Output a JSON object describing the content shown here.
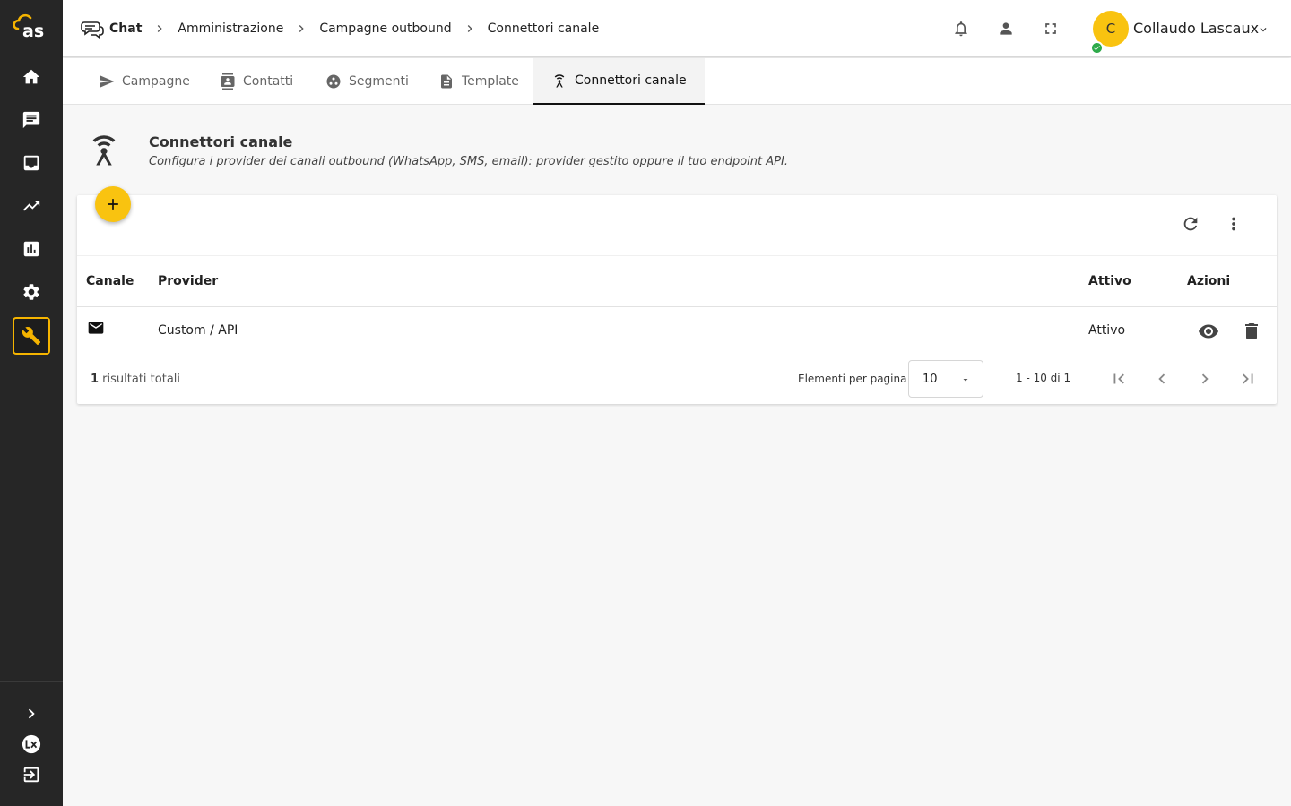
{
  "sidebar": {
    "logo_text": "as",
    "items": [
      {
        "name": "home",
        "active": false
      },
      {
        "name": "chat",
        "active": false
      },
      {
        "name": "inbox",
        "active": false
      },
      {
        "name": "trending",
        "active": false
      },
      {
        "name": "analytics",
        "active": false
      },
      {
        "name": "settings",
        "active": false
      },
      {
        "name": "tools",
        "active": true
      }
    ],
    "bottom": [
      "expand",
      "brand-badge",
      "logout"
    ]
  },
  "header": {
    "breadcrumbs": [
      "Chat",
      "Amministrazione",
      "Campagne outbound",
      "Connettori canale"
    ],
    "icons": [
      "bell-icon",
      "person-icon",
      "fullscreen-icon"
    ],
    "user": {
      "initial": "C",
      "name": "Collaudo Lascaux",
      "status": "online"
    }
  },
  "tabs": [
    {
      "label": "Campagne",
      "icon": "send-icon",
      "active": false
    },
    {
      "label": "Contatti",
      "icon": "contacts-icon",
      "active": false
    },
    {
      "label": "Segmenti",
      "icon": "segments-icon",
      "active": false
    },
    {
      "label": "Template",
      "icon": "document-icon",
      "active": false
    },
    {
      "label": "Connettori canale",
      "icon": "antenna-icon",
      "active": true
    }
  ],
  "page": {
    "title": "Connettori canale",
    "subtitle": "Configura i provider dei canali outbound (WhatsApp, SMS, email): provider gestito oppure il tuo endpoint API."
  },
  "table": {
    "columns": [
      "Canale",
      "Provider",
      "Attivo",
      "Azioni"
    ],
    "rows": [
      {
        "channel_icon": "email-icon",
        "provider": "Custom / API",
        "active": "Attivo"
      }
    ],
    "footer": {
      "total_count": "1",
      "total_label": " risultati totali",
      "per_page_label": "Elementi per pagina",
      "per_page_value": "10",
      "range": "1 - 10 di 1"
    }
  },
  "colors": {
    "accent": "#f9c310",
    "sidebar_bg": "#262626",
    "presence": "#2eaa4a"
  }
}
